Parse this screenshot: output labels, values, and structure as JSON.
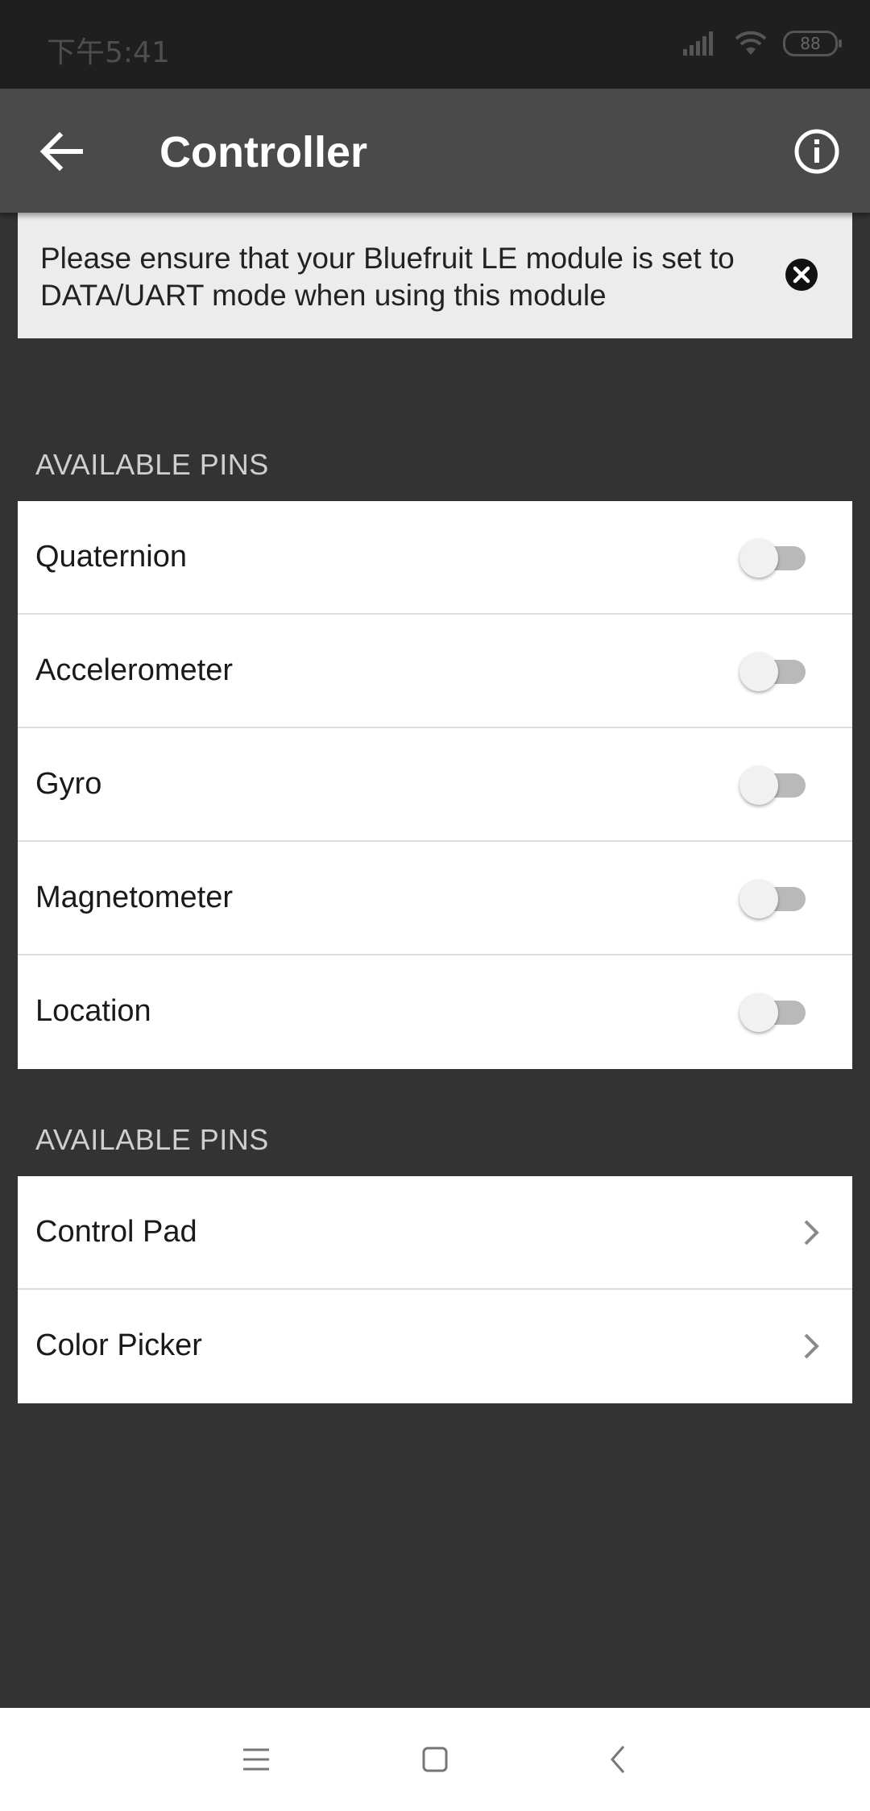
{
  "status_bar": {
    "time": "下午5:41",
    "battery": "88"
  },
  "app_bar": {
    "title": "Controller",
    "icons": [
      "back-arrow-icon",
      "info-icon"
    ]
  },
  "banner": {
    "text": "Please ensure that your Bluefruit LE module is set to DATA/UART mode when using this module",
    "icon": "close-circle-icon"
  },
  "sensors": {
    "header": "AVAILABLE PINS",
    "items": [
      {
        "label": "Quaternion",
        "enabled": false
      },
      {
        "label": "Accelerometer",
        "enabled": false
      },
      {
        "label": "Gyro",
        "enabled": false
      },
      {
        "label": "Magnetometer",
        "enabled": false
      },
      {
        "label": "Location",
        "enabled": false
      }
    ]
  },
  "modules": {
    "header": "AVAILABLE PINS",
    "items": [
      {
        "label": "Control Pad"
      },
      {
        "label": "Color Picker"
      }
    ]
  },
  "nav_bar": {
    "icons": [
      "menu-icon",
      "home-square-icon",
      "back-chevron-icon"
    ]
  },
  "colors": {
    "background": "#333333",
    "app_bar": "#4a4a4a",
    "status_bar": "#1f1f1f",
    "banner": "#ececec",
    "list": "#ffffff"
  }
}
